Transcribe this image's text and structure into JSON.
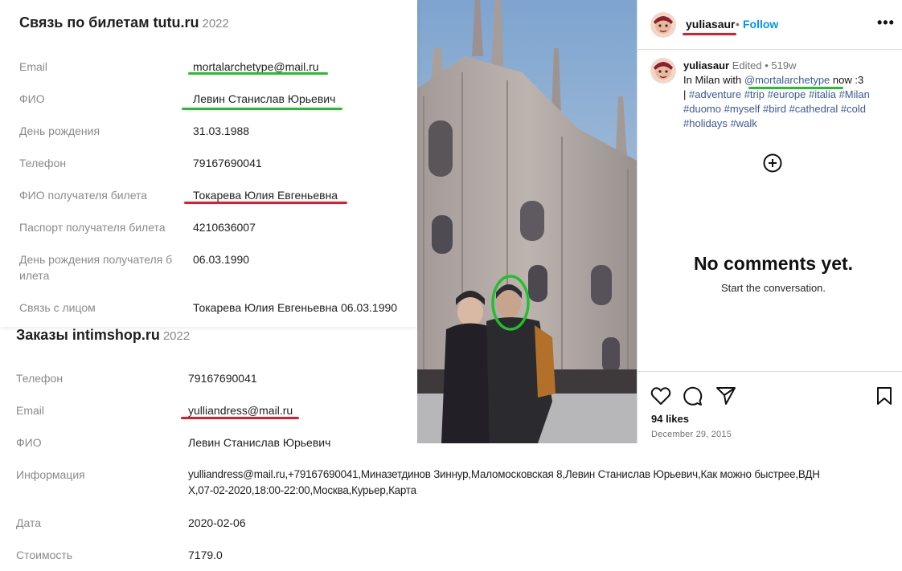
{
  "tutu": {
    "title": "Связь по билетам tutu.ru",
    "year": "2022",
    "rows": [
      {
        "label": "Email",
        "value": "mortalarchetype@mail.ru"
      },
      {
        "label": "ФИО",
        "value": "Левин Станислав Юрьевич"
      },
      {
        "label": "День рождения",
        "value": "31.03.1988"
      },
      {
        "label": "Телефон",
        "value": "79167690041"
      },
      {
        "label": "ФИО получателя билета",
        "value": "Токарева Юлия Евгеньевна"
      },
      {
        "label": "Паспорт получателя билета",
        "value": "4210636007"
      },
      {
        "label_line1": "День рождения получателя б",
        "label_line2": "илета",
        "value": "06.03.1990"
      },
      {
        "label": "Связь с лицом",
        "value": "Токарева Юлия Евгеньевна 06.03.1990"
      }
    ]
  },
  "intimshop": {
    "title": "Заказы intimshop.ru",
    "year": "2022",
    "rows": [
      {
        "label": "Телефон",
        "value": "79167690041"
      },
      {
        "label": "Email",
        "value": "yulliandress@mail.ru"
      },
      {
        "label": "ФИО",
        "value": "Левин Станислав Юрьевич"
      },
      {
        "label": "Информация",
        "value_line1": "yulliandress@mail.ru,+79167690041,Миназетдинов Зиннур,Маломосковская 8,Левин Станислав Юрьевич,Как можно быстрее,ВДН",
        "value_line2": "Х,07-02-2020,18:00-22:00,Москва,Курьер,Карта"
      },
      {
        "label": "Дата",
        "value": "2020-02-06"
      },
      {
        "label": "Стоимость",
        "value": "7179.0"
      }
    ]
  },
  "instagram": {
    "username": "yuliasaur",
    "separator": "•",
    "follow_label": "Follow",
    "more_label": "•••",
    "caption": {
      "username": "yuliasaur",
      "edited": "Edited",
      "dot": "•",
      "age": "519w",
      "text_before": "In Milan with ",
      "mention": "@mortalarchetype",
      "text_after": " now :3",
      "bar": "|",
      "hashtags": [
        "#adventure",
        "#trip",
        "#europe",
        "#italia",
        "#Milan",
        "#duomo",
        "#myself",
        "#bird",
        "#cathedral",
        "#cold",
        "#holidays",
        "#walk"
      ]
    },
    "no_comments": "No comments yet.",
    "start_conversation": "Start the conversation.",
    "likes": "94 likes",
    "date": "December 29, 2015",
    "icons": [
      "heart-icon",
      "comment-icon",
      "share-icon",
      "bookmark-icon",
      "add-comment-icon",
      "more-options-icon"
    ]
  },
  "colors": {
    "underline_green": "#22c02b",
    "underline_red": "#e8182c",
    "follow_blue": "#0095f6",
    "hashtag_blue": "#3b5998",
    "label_gray": "#8a8a8a"
  }
}
